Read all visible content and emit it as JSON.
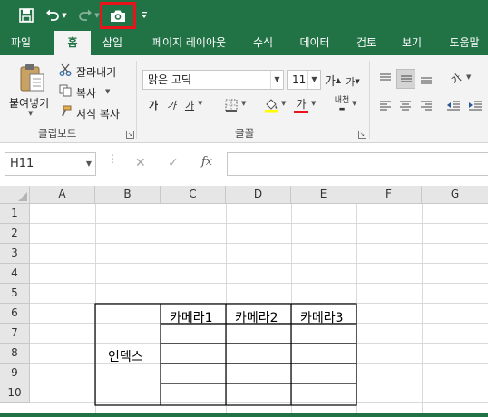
{
  "app": {
    "accent": "#217346",
    "highlight": "#e8141b"
  },
  "qat": {
    "icons": [
      "save-icon",
      "undo-icon",
      "redo-icon",
      "camera-icon",
      "customize-qat-icon"
    ]
  },
  "tabs": [
    "파일",
    "홈",
    "삽입",
    "페이지 레이아웃",
    "수식",
    "데이터",
    "검토",
    "보기",
    "도움말"
  ],
  "active_tab": "홈",
  "clipboard": {
    "paste_label": "붙여넣기",
    "cut_label": "잘라내기",
    "copy_label": "복사",
    "format_painter_label": "서식 복사",
    "group_label": "클립보드"
  },
  "font": {
    "font_name": "맑은 고딕",
    "font_size": "11",
    "grow_label": "가",
    "shrink_label": "가",
    "bold_label": "가",
    "italic_label": "가",
    "underline_label": "가",
    "font_color_label": "가",
    "phonetic_label": "내천",
    "group_label": "글꼴"
  },
  "alignment": {
    "orientation_label": "가"
  },
  "formula_bar": {
    "name_box": "H11",
    "fx_label": "fx",
    "cancel": "✕",
    "enter": "✓"
  },
  "sheet": {
    "columns": [
      "A",
      "B",
      "C",
      "D",
      "E",
      "F",
      "G"
    ],
    "rows": [
      "1",
      "2",
      "3",
      "4",
      "5",
      "6",
      "7",
      "8",
      "9",
      "10"
    ],
    "table": {
      "headers": [
        "카메라1",
        "카메라2",
        "카메라3"
      ],
      "row_label": "인덱스"
    }
  }
}
